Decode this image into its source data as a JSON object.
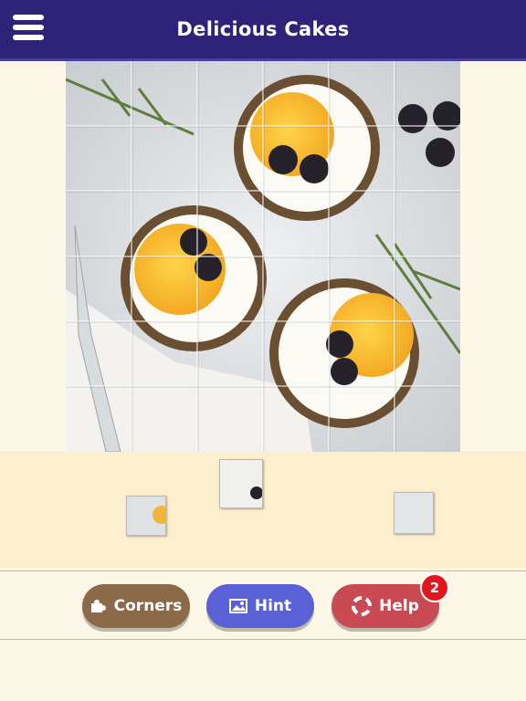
{
  "header": {
    "title": "Delicious Cakes",
    "menu_icon": "hamburger-menu-icon"
  },
  "puzzle": {
    "grid_cols": 6,
    "grid_rows": 6,
    "image_subject": "fruit tarts with orange slices, blackberries and rosemary",
    "tray_piece_count": 3
  },
  "buttons": {
    "corners_label": "Corners",
    "hint_label": "Hint",
    "help_label": "Help",
    "help_badge": "2"
  },
  "colors": {
    "header": "#2f2379",
    "background": "#fbf6e6",
    "tray": "#fdeecd",
    "corners_button": "#8a6a49",
    "hint_button": "#5a60d6",
    "help_button": "#c94a52",
    "badge": "#e2161c"
  }
}
